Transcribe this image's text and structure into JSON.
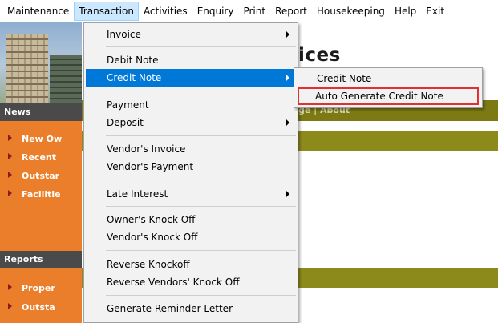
{
  "menubar": [
    {
      "label": "Maintenance"
    },
    {
      "label": "Transaction",
      "active": true
    },
    {
      "label": "Activities"
    },
    {
      "label": "Enquiry"
    },
    {
      "label": "Print"
    },
    {
      "label": "Report"
    },
    {
      "label": "Housekeeping"
    },
    {
      "label": "Help"
    },
    {
      "label": "Exit"
    }
  ],
  "transaction_menu": {
    "items": [
      {
        "label": "Invoice",
        "submenu": true
      },
      {
        "label": "Debit Note"
      },
      {
        "label": "Credit Note",
        "submenu": true,
        "highlighted": true
      },
      {
        "label": "Payment"
      },
      {
        "label": "Deposit",
        "submenu": true
      },
      {
        "label": "Vendor's Invoice"
      },
      {
        "label": "Vendor's Payment"
      },
      {
        "label": "Late Interest",
        "submenu": true
      },
      {
        "label": "Owner's Knock Off"
      },
      {
        "label": "Vendor's Knock Off"
      },
      {
        "label": "Reverse Knockoff"
      },
      {
        "label": "Reverse Vendors' Knock Off"
      },
      {
        "label": "Generate Reminder Letter"
      }
    ]
  },
  "credit_note_submenu": {
    "items": [
      {
        "label": "Credit Note"
      },
      {
        "label": "Auto Generate Credit Note",
        "boxed": true
      }
    ]
  },
  "sidebar": {
    "news_header": "News",
    "news_links": [
      "New Ow",
      "Recent",
      "Outstar",
      "Facilitie"
    ],
    "reports_header": "Reports",
    "reports_links": [
      "Proper",
      "Outsta"
    ]
  },
  "background": {
    "title_fragment": "ices",
    "nav_fragment": "ge  |  About"
  },
  "colors": {
    "menu_highlight": "#0078d7",
    "menubar_active": "#cce8ff",
    "sidebar_orange": "#ea7e2a",
    "band_olive": "#8d8a1c",
    "callout_red": "#e03030"
  }
}
